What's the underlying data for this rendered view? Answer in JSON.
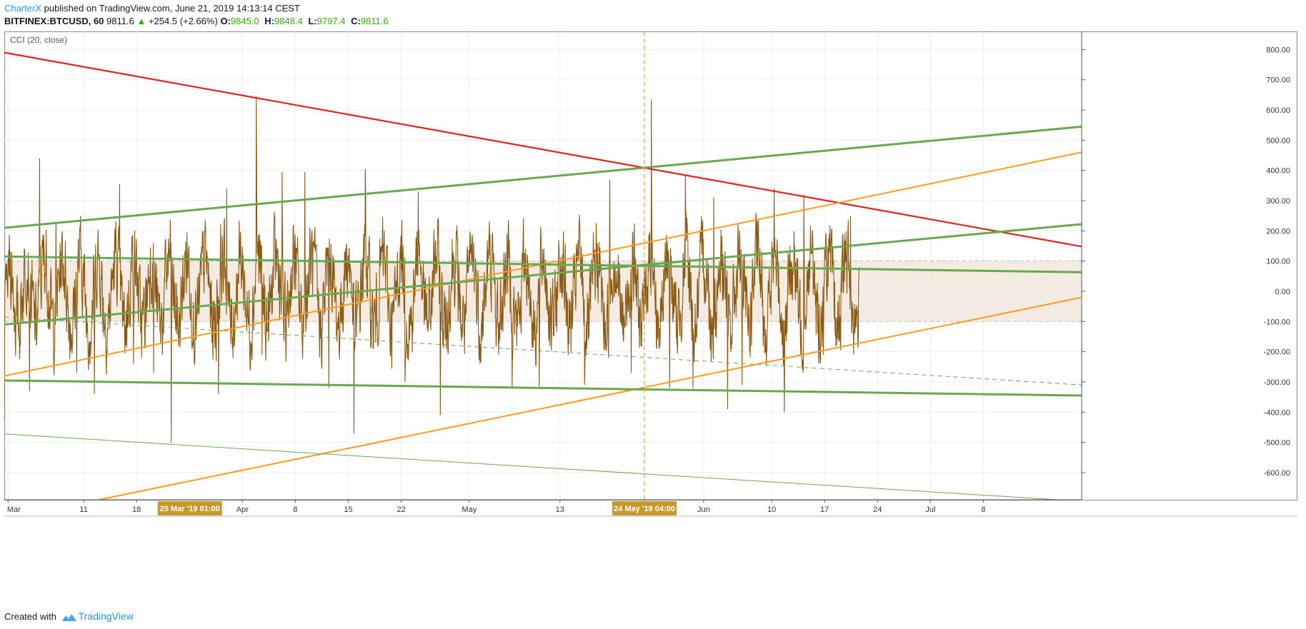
{
  "header": {
    "author": "CharterX",
    "published": " published on TradingView.com, June 21, 2019 14:13:14 CEST",
    "symbol": "BITFINEX:BTCUSD, 60",
    "last": "9811.6",
    "change": "+254.5 (+2.66%)",
    "o_label": "O:",
    "o_value": "9845.0",
    "h_label": "H:",
    "h_value": "9848.4",
    "l_label": "L:",
    "l_value": "9797.4",
    "c_label": "C:",
    "c_value": "9811.6"
  },
  "footer": {
    "created": "Created with",
    "brand": "TradingView"
  },
  "chart_data": {
    "type": "line",
    "indicator_label": "CCI (20, close)",
    "ylim": [
      -690,
      860
    ],
    "y_ticks": [
      800,
      700,
      600,
      500,
      400,
      300,
      200,
      100,
      0,
      -100,
      -200,
      -300,
      -400,
      -500,
      -600
    ],
    "y_tick_labels": [
      "800.00",
      "700.00",
      "600.00",
      "500.00",
      "400.00",
      "300.00",
      "200.00",
      "100.00",
      "0.00",
      "-100.00",
      "-200.00",
      "-300.00",
      "-400.00",
      "-500.00",
      "-600.00"
    ],
    "x_start": "2019-02-28T12:00",
    "x_end": "2019-07-21T00:00",
    "x_ticks": [
      {
        "date": "2019-03-01",
        "label": "Mar"
      },
      {
        "date": "2019-03-11",
        "label": "11"
      },
      {
        "date": "2019-03-18",
        "label": "18"
      },
      {
        "date": "2019-04-01",
        "label": "Apr"
      },
      {
        "date": "2019-04-08",
        "label": "8"
      },
      {
        "date": "2019-04-15",
        "label": "15"
      },
      {
        "date": "2019-04-22",
        "label": "22"
      },
      {
        "date": "2019-05-01",
        "label": "May"
      },
      {
        "date": "2019-05-13",
        "label": "13"
      },
      {
        "date": "2019-06-01",
        "label": "Jun"
      },
      {
        "date": "2019-06-10",
        "label": "10"
      },
      {
        "date": "2019-06-17",
        "label": "17"
      },
      {
        "date": "2019-06-24",
        "label": "24"
      },
      {
        "date": "2019-07-01",
        "label": "Jul"
      },
      {
        "date": "2019-07-08",
        "label": "8"
      }
    ],
    "x_highlights": [
      {
        "date": "2019-03-25T01:00",
        "label": "25 Mar '19    01:00"
      },
      {
        "date": "2019-05-24T04:00",
        "label": "24 May '19    04:00"
      }
    ],
    "crosshair_date": "2019-05-24T04:00",
    "band": {
      "upper": 100,
      "lower": -100,
      "fill": "#f0e6da"
    },
    "cci_series": {
      "name": "CCI",
      "color": "#8b5a14",
      "x_start": "2019-02-28T12:00",
      "x_end": "2019-06-21T14:00",
      "spikes": [
        {
          "date": "2019-02-28T12:00",
          "value": -430
        },
        {
          "date": "2019-03-03T20:00",
          "value": -330
        },
        {
          "date": "2019-03-05T04:00",
          "value": 440
        },
        {
          "date": "2019-03-07T08:00",
          "value": 230
        },
        {
          "date": "2019-03-10T02:00",
          "value": -270
        },
        {
          "date": "2019-03-12T10:00",
          "value": -340
        },
        {
          "date": "2019-03-15T18:00",
          "value": 355
        },
        {
          "date": "2019-03-17T14:00",
          "value": -240
        },
        {
          "date": "2019-03-20T06:00",
          "value": -270
        },
        {
          "date": "2019-03-22T14:00",
          "value": -500
        },
        {
          "date": "2019-03-25T10:00",
          "value": -170
        },
        {
          "date": "2019-03-28T20:00",
          "value": -340
        },
        {
          "date": "2019-03-29T22:00",
          "value": 340
        },
        {
          "date": "2019-04-02T20:00",
          "value": 645
        },
        {
          "date": "2019-04-03T14:00",
          "value": -210
        },
        {
          "date": "2019-04-06T06:00",
          "value": 395
        },
        {
          "date": "2019-04-09T06:00",
          "value": 395
        },
        {
          "date": "2019-04-12T10:00",
          "value": -320
        },
        {
          "date": "2019-04-15T18:00",
          "value": -470
        },
        {
          "date": "2019-04-17T06:00",
          "value": 405
        },
        {
          "date": "2019-04-22T12:00",
          "value": -300
        },
        {
          "date": "2019-04-24T06:00",
          "value": 330
        },
        {
          "date": "2019-04-27T04:00",
          "value": -410
        },
        {
          "date": "2019-05-06T16:00",
          "value": -320
        },
        {
          "date": "2019-05-10T06:00",
          "value": -320
        },
        {
          "date": "2019-05-16T06:00",
          "value": -310
        },
        {
          "date": "2019-05-19T14:00",
          "value": 370
        },
        {
          "date": "2019-05-22T10:00",
          "value": -270
        },
        {
          "date": "2019-05-25T02:00",
          "value": 635
        },
        {
          "date": "2019-05-27T12:00",
          "value": -320
        },
        {
          "date": "2019-05-29T14:00",
          "value": 385
        },
        {
          "date": "2019-05-30T14:00",
          "value": -320
        },
        {
          "date": "2019-06-02T08:00",
          "value": 310
        },
        {
          "date": "2019-06-04T04:00",
          "value": -390
        },
        {
          "date": "2019-06-06T02:00",
          "value": -310
        },
        {
          "date": "2019-06-10T08:00",
          "value": 340
        },
        {
          "date": "2019-06-11T16:00",
          "value": -400
        },
        {
          "date": "2019-06-14T06:00",
          "value": 320
        },
        {
          "date": "2019-06-16T20:00",
          "value": -210
        },
        {
          "date": "2019-06-18T10:00",
          "value": -150
        },
        {
          "date": "2019-06-20T10:00",
          "value": 250
        },
        {
          "date": "2019-06-21T14:00",
          "value": 80
        }
      ]
    },
    "trend_lines": [
      {
        "name": "red-descending",
        "color": "#e8201a",
        "width": 2.2,
        "dash": false,
        "from": {
          "date": "2019-02-28T12:00",
          "value": 790
        },
        "to": {
          "date": "2019-07-21T00:00",
          "value": 148
        }
      },
      {
        "name": "green-upper-channel",
        "color": "#6aa84f",
        "width": 3,
        "dash": false,
        "from": {
          "date": "2019-02-28T12:00",
          "value": 210
        },
        "to": {
          "date": "2019-07-21T00:00",
          "value": 545
        }
      },
      {
        "name": "orange-upper",
        "color": "#ff9a1f",
        "width": 2,
        "dash": false,
        "from": {
          "date": "2019-02-28T12:00",
          "value": -280
        },
        "to": {
          "date": "2019-07-21T00:00",
          "value": 460
        }
      },
      {
        "name": "green-mid-rising",
        "color": "#6aa84f",
        "width": 3,
        "dash": false,
        "from": {
          "date": "2019-02-28T12:00",
          "value": -110
        },
        "to": {
          "date": "2019-07-21T00:00",
          "value": 222
        }
      },
      {
        "name": "green-flat",
        "color": "#6aa84f",
        "width": 3,
        "dash": false,
        "from": {
          "date": "2019-02-28T12:00",
          "value": 115
        },
        "to": {
          "date": "2019-07-21T00:00",
          "value": 63
        }
      },
      {
        "name": "green-dashed",
        "color": "#6aa84f",
        "width": 1,
        "dash": true,
        "from": {
          "date": "2019-02-28T12:00",
          "value": -85
        },
        "to": {
          "date": "2019-07-21T00:00",
          "value": -310
        }
      },
      {
        "name": "orange-lower",
        "color": "#ff9a1f",
        "width": 2,
        "dash": false,
        "from": {
          "date": "2019-03-13T00:00",
          "value": -690
        },
        "to": {
          "date": "2019-07-21T00:00",
          "value": -20
        }
      },
      {
        "name": "green-lower-channel",
        "color": "#6aa84f",
        "width": 3,
        "dash": false,
        "from": {
          "date": "2019-02-28T12:00",
          "value": -295
        },
        "to": {
          "date": "2019-07-21T00:00",
          "value": -345
        }
      },
      {
        "name": "green-thin-bottom",
        "color": "#6aa84f",
        "width": 1,
        "dash": false,
        "from": {
          "date": "2019-02-28T12:00",
          "value": -472
        },
        "to": {
          "date": "2019-07-21T00:00",
          "value": -695
        }
      }
    ],
    "colors": {
      "grid": "#e9eef3",
      "axis": "#50535e",
      "crosshair": "#f0a030",
      "highlight_label_bg": "#c59a2a"
    }
  }
}
